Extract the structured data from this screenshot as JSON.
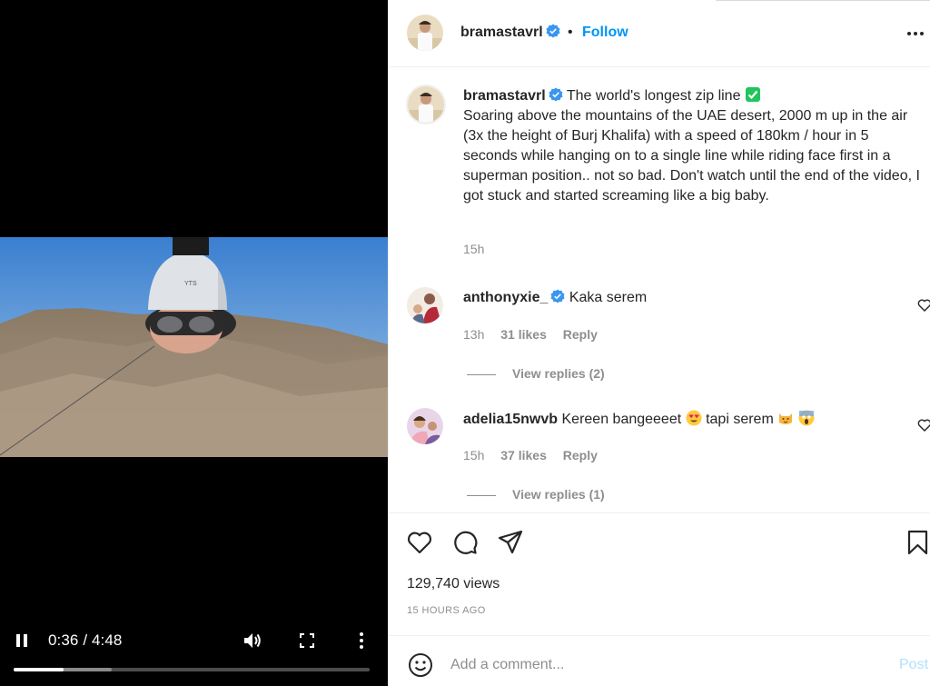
{
  "video": {
    "current_time": "0:36",
    "duration": "4:48",
    "time_separator": " / ",
    "progress_fraction": 0.14,
    "buffered_fraction": 0.275
  },
  "post": {
    "author": "bramastavrl",
    "follow_label": "Follow",
    "separator": "•",
    "caption_title": "The world's longest zip line",
    "caption_body": "Soaring above the mountains of the UAE desert, 2000 m up in the air (3x the height of Burj Khalifa) with a speed of 180km / hour in 5 seconds while hanging on to a single line while riding face first in a superman position.. not so bad. Don't watch until the end of the video, I got stuck and started screaming like a big baby.",
    "caption_time": "15h",
    "views": "129,740 views",
    "age": "15 HOURS AGO"
  },
  "comments": [
    {
      "username": "anthonyxie_",
      "text": "Kaka serem",
      "time": "13h",
      "likes": "31 likes",
      "reply_label": "Reply",
      "view_replies": "View replies (2)"
    },
    {
      "username": "adelia15nwvb",
      "text_parts": [
        "Kereen bangeeeet",
        "tapi serem"
      ],
      "time": "15h",
      "likes": "37 likes",
      "reply_label": "Reply",
      "view_replies": "View replies (1)"
    }
  ],
  "composer": {
    "placeholder": "Add a comment...",
    "post_label": "Post"
  },
  "colors": {
    "link_blue": "#0095f6",
    "muted": "#8e8e8e",
    "post_disabled": "#b2dffc",
    "verified_blue": "#3897f0",
    "check_green": "#21c45d"
  },
  "icons": {
    "video": [
      "pause-icon",
      "volume-icon",
      "fullscreen-icon",
      "more-vertical-icon"
    ],
    "actions": [
      "heart-icon",
      "comment-icon",
      "share-icon",
      "bookmark-icon"
    ],
    "misc": [
      "verified-badge-icon",
      "check-box-emoji",
      "heart-eyes-emoji",
      "cat-emoji",
      "screaming-emoji",
      "smiley-icon",
      "more-horizontal-icon"
    ]
  }
}
